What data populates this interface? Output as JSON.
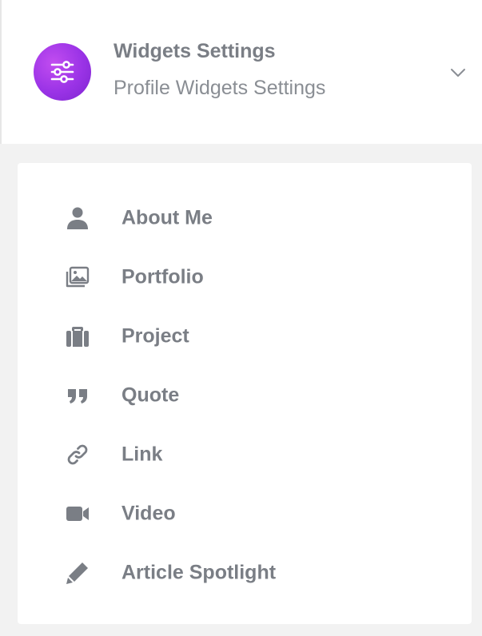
{
  "header": {
    "title": "Widgets Settings",
    "subtitle": "Profile Widgets Settings",
    "icon": "sliders-icon",
    "toggle_icon": "chevron-down-icon",
    "accent_color": "#a43ae8"
  },
  "menu": {
    "items": [
      {
        "label": "About Me",
        "icon": "user-icon"
      },
      {
        "label": "Portfolio",
        "icon": "images-icon"
      },
      {
        "label": "Project",
        "icon": "suitcase-icon"
      },
      {
        "label": "Quote",
        "icon": "quote-icon"
      },
      {
        "label": "Link",
        "icon": "link-icon"
      },
      {
        "label": "Video",
        "icon": "video-camera-icon"
      },
      {
        "label": "Article Spotlight",
        "icon": "pencil-icon"
      }
    ]
  }
}
